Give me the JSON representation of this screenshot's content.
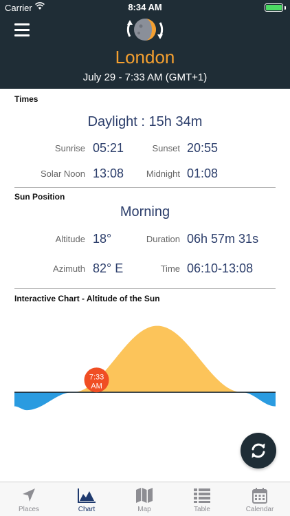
{
  "status_bar": {
    "carrier": "Carrier",
    "time": "8:34 AM"
  },
  "header": {
    "city": "London",
    "datetime": "July 29 - 7:33 AM (GMT+1)"
  },
  "times": {
    "section_title": "Times",
    "daylight": "Daylight : 15h 34m",
    "sunrise_label": "Sunrise",
    "sunrise_value": "05:21",
    "sunset_label": "Sunset",
    "sunset_value": "20:55",
    "solar_noon_label": "Solar Noon",
    "solar_noon_value": "13:08",
    "midnight_label": "Midnight",
    "midnight_value": "01:08"
  },
  "sun_position": {
    "section_title": "Sun Position",
    "phase": "Morning",
    "altitude_label": "Altitude",
    "altitude_value": "18°",
    "duration_label": "Duration",
    "duration_value": "06h 57m 31s",
    "azimuth_label": "Azimuth",
    "azimuth_value": "82° E",
    "time_label": "Time",
    "time_value": "06:10-13:08"
  },
  "chart_section": {
    "title": "Interactive Chart - Altitude of the Sun"
  },
  "chart_data": {
    "type": "area",
    "title": "Interactive Chart - Altitude of the Sun",
    "xlabel": "",
    "ylabel": "",
    "x_hours": [
      0,
      1.13,
      5.35,
      13.13,
      20.92,
      24
    ],
    "y_altitude": [
      -11,
      -14,
      0,
      52,
      0,
      -11
    ],
    "xlim": [
      0,
      24
    ],
    "ylim": [
      -15,
      55
    ],
    "current_time": 7.55,
    "marker_label_time": "7:33",
    "marker_label_period": "AM",
    "colors": {
      "day": "#fcc45a",
      "night": "#2a9be0",
      "horizon": "#1f2d36",
      "marker": "#f04e23"
    }
  },
  "tabs": [
    {
      "label": "Places",
      "icon": "location-arrow-icon",
      "active": false
    },
    {
      "label": "Chart",
      "icon": "area-chart-icon",
      "active": true
    },
    {
      "label": "Map",
      "icon": "map-icon",
      "active": false
    },
    {
      "label": "Table",
      "icon": "table-list-icon",
      "active": false
    },
    {
      "label": "Calendar",
      "icon": "calendar-icon",
      "active": false
    }
  ],
  "colors": {
    "header_bg": "#1f2d36",
    "accent": "#f5a030",
    "value_text": "#2c3e6b",
    "tab_active": "#1f3a6e"
  }
}
